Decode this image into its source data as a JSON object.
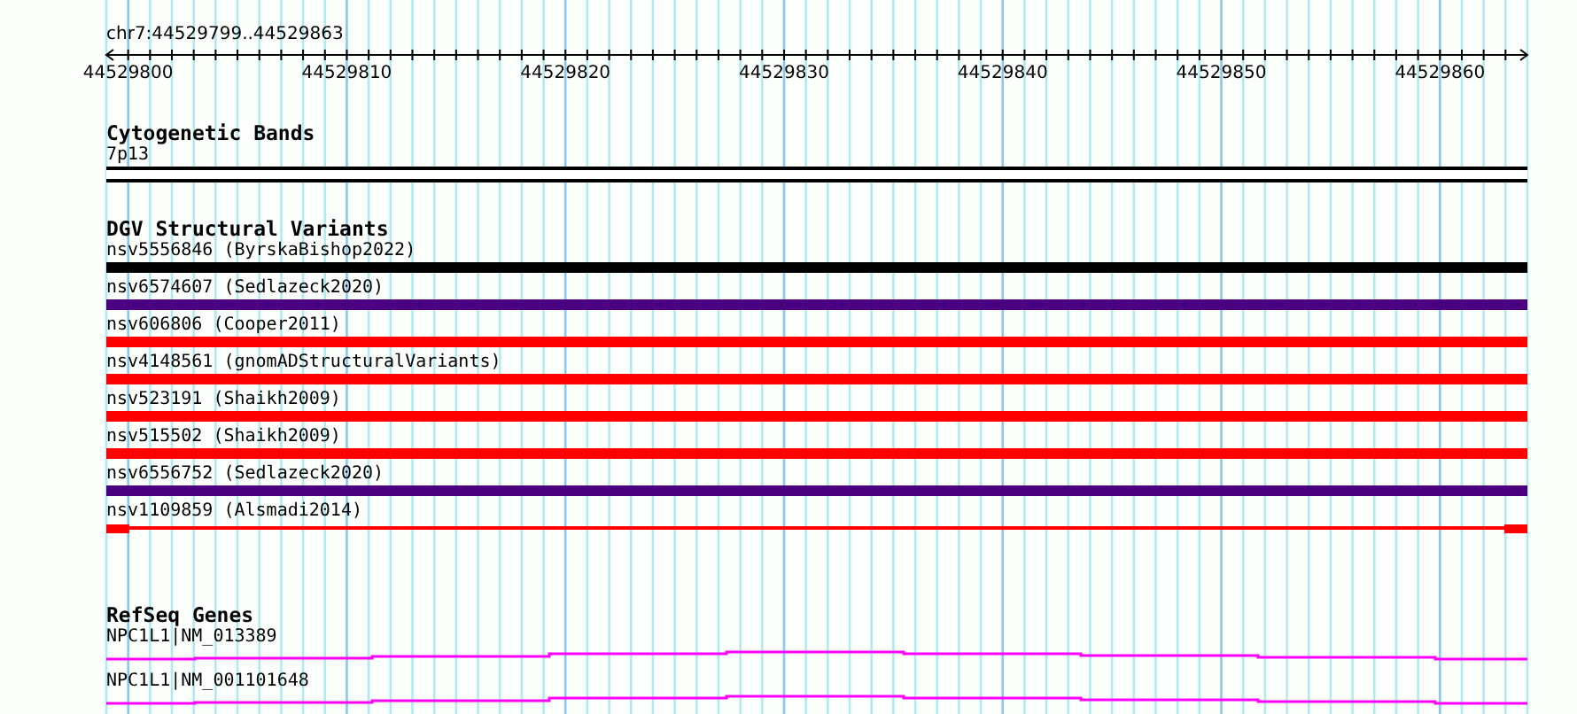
{
  "location": "chr7:44529799..44529863",
  "ruler": {
    "labels": [
      "44529800",
      "44529810",
      "44529820",
      "44529830",
      "44529840",
      "44529850",
      "44529860"
    ]
  },
  "tracks": [
    {
      "kind": "bands",
      "title": "Cytogenetic Bands",
      "features": [
        {
          "label": "7p13"
        }
      ]
    },
    {
      "kind": "variants",
      "title": "DGV Structural Variants",
      "features": [
        {
          "label": "nsv5556846 (ByrskaBishop2022)",
          "color": "#000000",
          "kind": "bar"
        },
        {
          "label": "nsv6574607 (Sedlazeck2020)",
          "color": "#4b0082",
          "kind": "bar"
        },
        {
          "label": "nsv606806 (Cooper2011)",
          "color": "#ff0000",
          "kind": "bar"
        },
        {
          "label": "nsv4148561 (gnomADStructuralVariants)",
          "color": "#ff0000",
          "kind": "bar"
        },
        {
          "label": "nsv523191 (Shaikh2009)",
          "color": "#ff0000",
          "kind": "bar"
        },
        {
          "label": "nsv515502 (Shaikh2009)",
          "color": "#ff0000",
          "kind": "bar"
        },
        {
          "label": "nsv6556752 (Sedlazeck2020)",
          "color": "#4b0082",
          "kind": "bar"
        },
        {
          "label": "nsv1109859 (Alsmadi2014)",
          "color": "#ff0000",
          "kind": "span"
        }
      ]
    },
    {
      "kind": "genes",
      "title": "RefSeq Genes",
      "features": [
        {
          "label": "NPC1L1|NM_013389"
        },
        {
          "label": "NPC1L1|NM_001101648"
        }
      ]
    }
  ]
}
